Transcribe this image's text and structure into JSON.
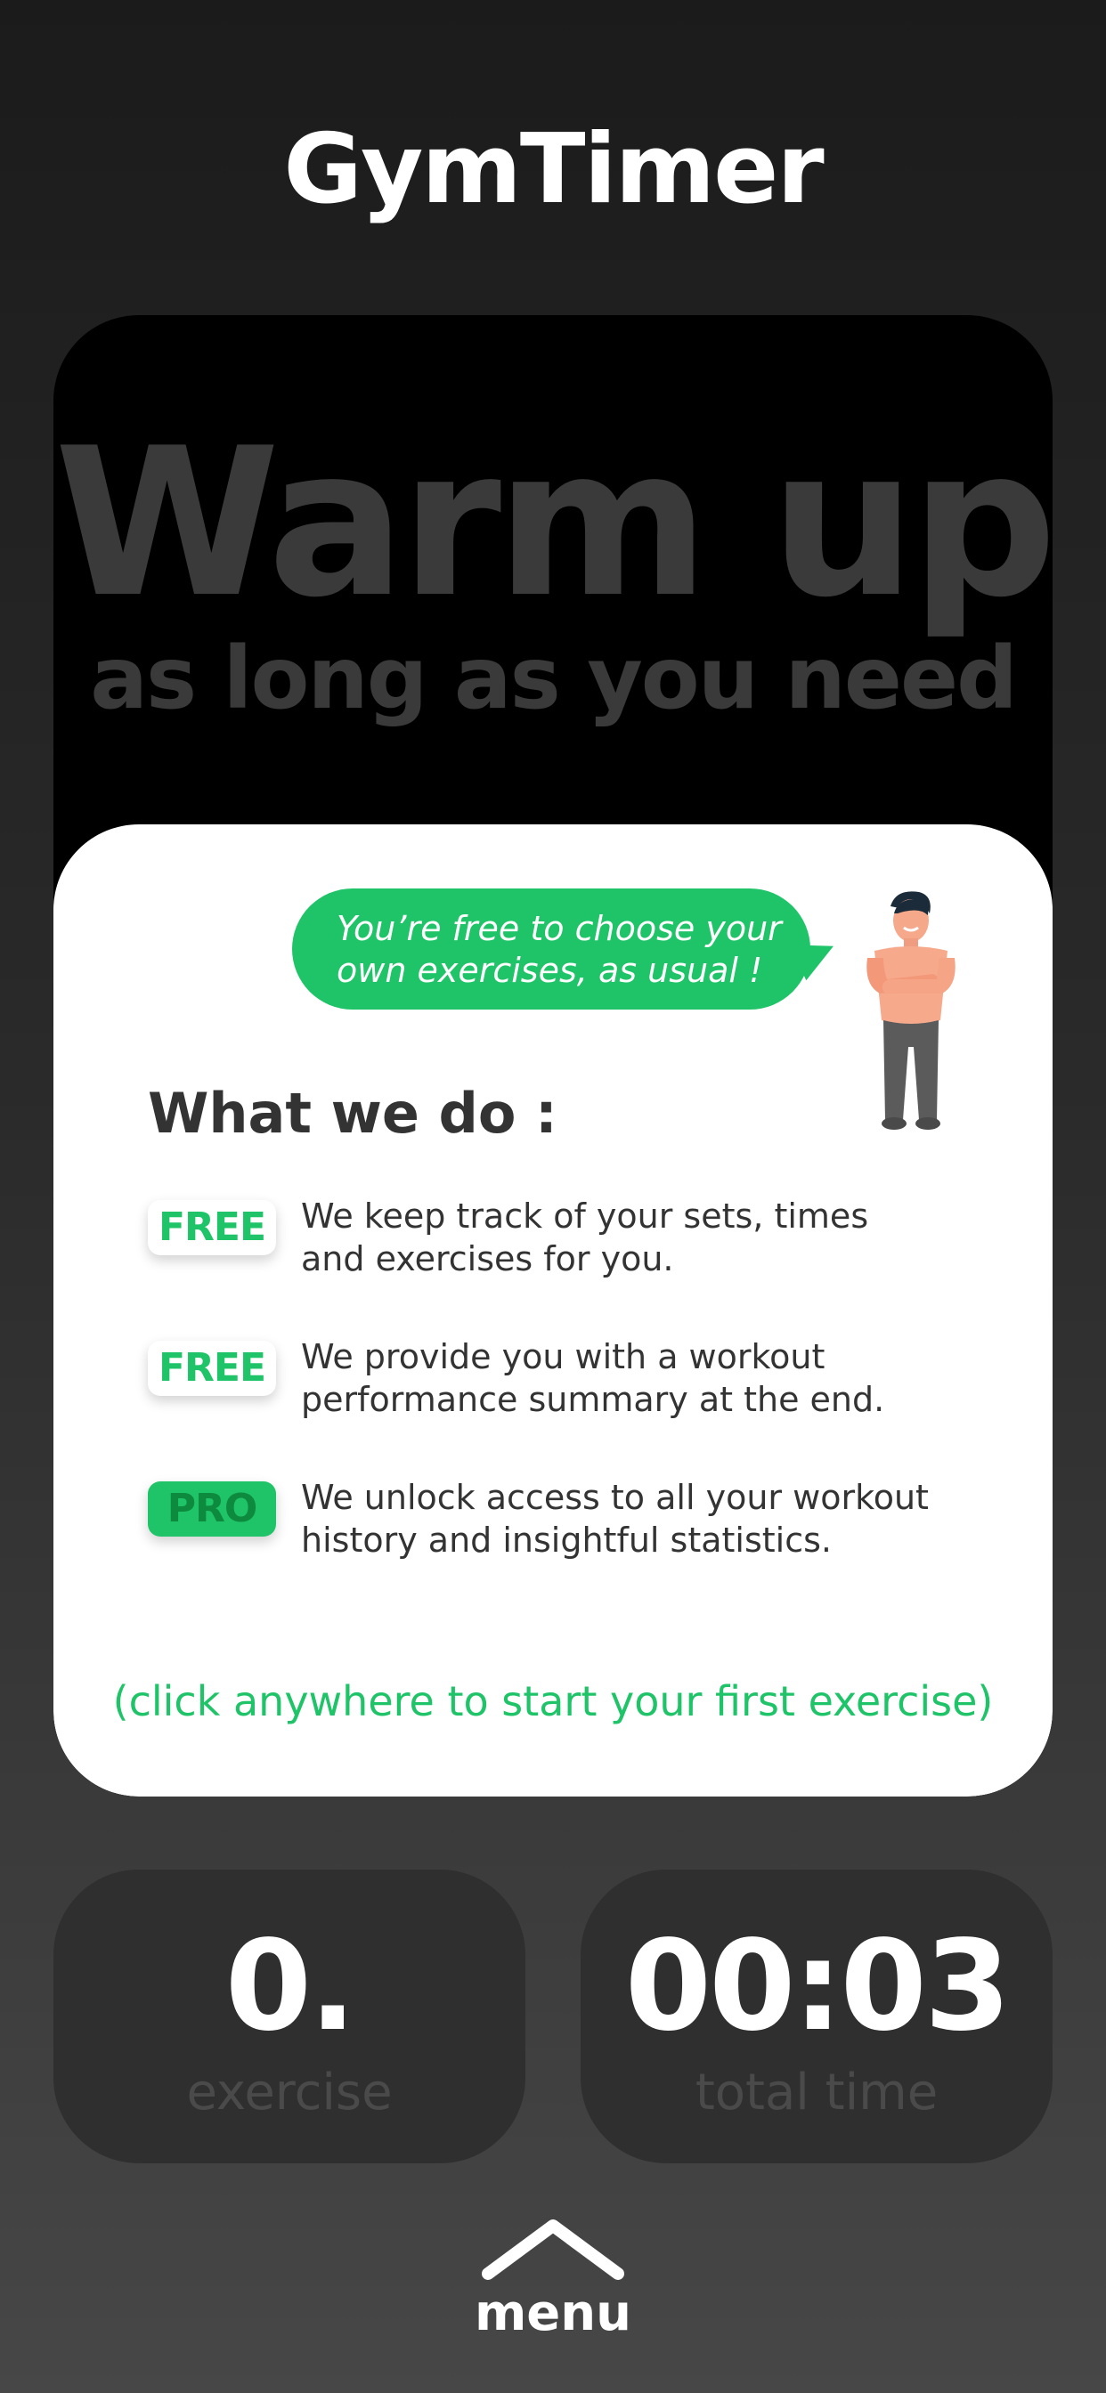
{
  "header": {
    "title": "GymTimer"
  },
  "hero": {
    "title": "Warm up",
    "subtitle": "as long as you need"
  },
  "info_panel": {
    "speech_bubble": {
      "line1": "You’re free to choose your",
      "line2": "own exercises, as usual !"
    },
    "heading": "What we do :",
    "features": [
      {
        "badge": "FREE",
        "line1": "We keep track of your sets, times",
        "line2": "and exercises for you."
      },
      {
        "badge": "FREE",
        "line1": "We provide you with a workout",
        "line2": "performance summary at the end."
      },
      {
        "badge": "PRO",
        "line1": "We unlock access to all your workout",
        "line2": "history and insightful statistics."
      }
    ],
    "hint": "(click anywhere to start your first exercise)"
  },
  "stats": {
    "exercise": {
      "value": "0.",
      "label": "exercise"
    },
    "total_time": {
      "value": "00:03",
      "label": "total time"
    }
  },
  "menu": {
    "label": "menu"
  },
  "colors": {
    "accent": "#1ec467",
    "card": "#000000",
    "panel": "#ffffff",
    "stat_card": "#2f2f2f"
  }
}
